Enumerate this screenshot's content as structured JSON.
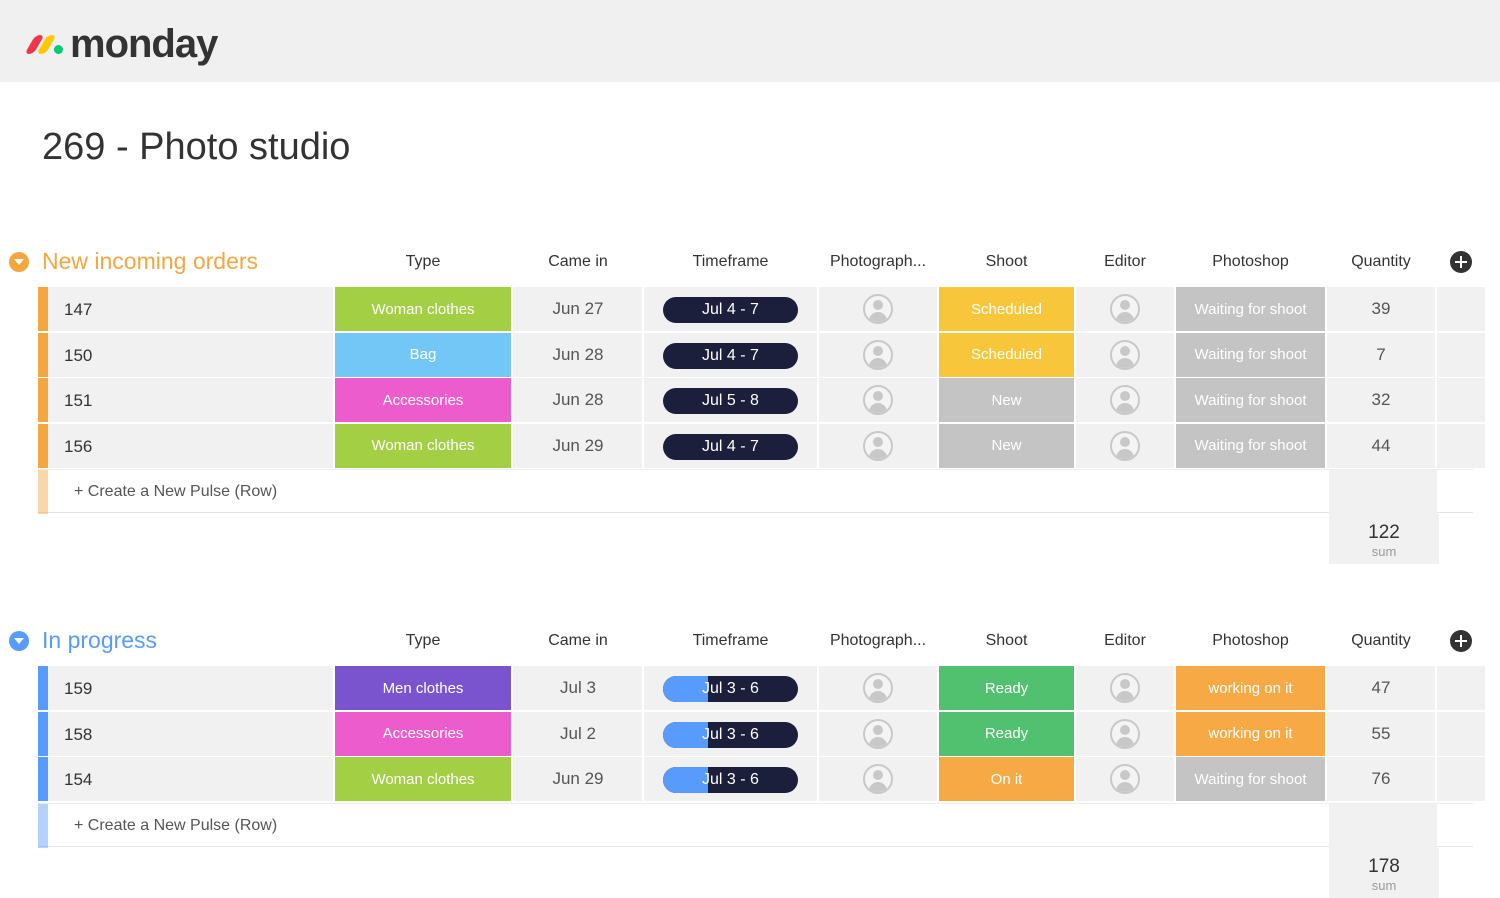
{
  "app": {
    "logo_text": "monday",
    "board_title": "269 - Photo studio"
  },
  "columns": {
    "type": "Type",
    "came_in": "Came in",
    "timeframe": "Timeframe",
    "photographer": "Photograph...",
    "shoot": "Shoot",
    "editor": "Editor",
    "photoshop": "Photoshop",
    "quantity": "Quantity"
  },
  "colors": {
    "orange_group": "#f4a640",
    "blue_group": "#579bfc",
    "woman_clothes": "#a3cf44",
    "bag": "#72c7f6",
    "accessories": "#ec5ccc",
    "men_clothes": "#7a54cf",
    "scheduled": "#f8c63a",
    "new": "#c4c4c4",
    "ready": "#51c16f",
    "on_it": "#f6a944",
    "waiting": "#c4c4c4",
    "working": "#f6a944",
    "timeline_dark": "#1c1f3b",
    "timeline_fill": "#579bfc"
  },
  "groups": [
    {
      "title": "New incoming orders",
      "color": "#f4a640",
      "rows": [
        {
          "name": "147",
          "type": "Woman clothes",
          "type_color": "#a3cf44",
          "came_in": "Jun 27",
          "timeframe": "Jul 4 - 7",
          "timeframe_progress": 0,
          "shoot": "Scheduled",
          "shoot_color": "#f8c63a",
          "photoshop": "Waiting for shoot",
          "photoshop_color": "#c4c4c4",
          "quantity": "39"
        },
        {
          "name": "150",
          "type": "Bag",
          "type_color": "#72c7f6",
          "came_in": "Jun 28",
          "timeframe": "Jul 4 - 7",
          "timeframe_progress": 0,
          "shoot": "Scheduled",
          "shoot_color": "#f8c63a",
          "photoshop": "Waiting for shoot",
          "photoshop_color": "#c4c4c4",
          "quantity": "7"
        },
        {
          "name": "151",
          "type": "Accessories",
          "type_color": "#ec5ccc",
          "came_in": "Jun 28",
          "timeframe": "Jul 5 - 8",
          "timeframe_progress": 0,
          "shoot": "New",
          "shoot_color": "#c4c4c4",
          "photoshop": "Waiting for shoot",
          "photoshop_color": "#c4c4c4",
          "quantity": "32"
        },
        {
          "name": "156",
          "type": "Woman clothes",
          "type_color": "#a3cf44",
          "came_in": "Jun 29",
          "timeframe": "Jul 4 - 7",
          "timeframe_progress": 0,
          "shoot": "New",
          "shoot_color": "#c4c4c4",
          "photoshop": "Waiting for shoot",
          "photoshop_color": "#c4c4c4",
          "quantity": "44"
        }
      ],
      "create_label": "+ Create a New Pulse (Row)",
      "sum_value": "122",
      "sum_label": "sum"
    },
    {
      "title": "In progress",
      "color": "#579bfc",
      "rows": [
        {
          "name": "159",
          "type": "Men clothes",
          "type_color": "#7a54cf",
          "came_in": "Jul 3",
          "timeframe": "Jul 3 - 6",
          "timeframe_progress": 0.33,
          "shoot": "Ready",
          "shoot_color": "#51c16f",
          "photoshop": "working on it",
          "photoshop_color": "#f6a944",
          "quantity": "47"
        },
        {
          "name": "158",
          "type": "Accessories",
          "type_color": "#ec5ccc",
          "came_in": "Jul 2",
          "timeframe": "Jul 3 - 6",
          "timeframe_progress": 0.33,
          "shoot": "Ready",
          "shoot_color": "#51c16f",
          "photoshop": "working on it",
          "photoshop_color": "#f6a944",
          "quantity": "55"
        },
        {
          "name": "154",
          "type": "Woman clothes",
          "type_color": "#a3cf44",
          "came_in": "Jun 29",
          "timeframe": "Jul 3 - 6",
          "timeframe_progress": 0.33,
          "shoot": "On it",
          "shoot_color": "#f6a944",
          "photoshop": "Waiting for shoot",
          "photoshop_color": "#c4c4c4",
          "quantity": "76"
        }
      ],
      "create_label": "+ Create a New Pulse (Row)",
      "sum_value": "178",
      "sum_label": "sum"
    }
  ]
}
